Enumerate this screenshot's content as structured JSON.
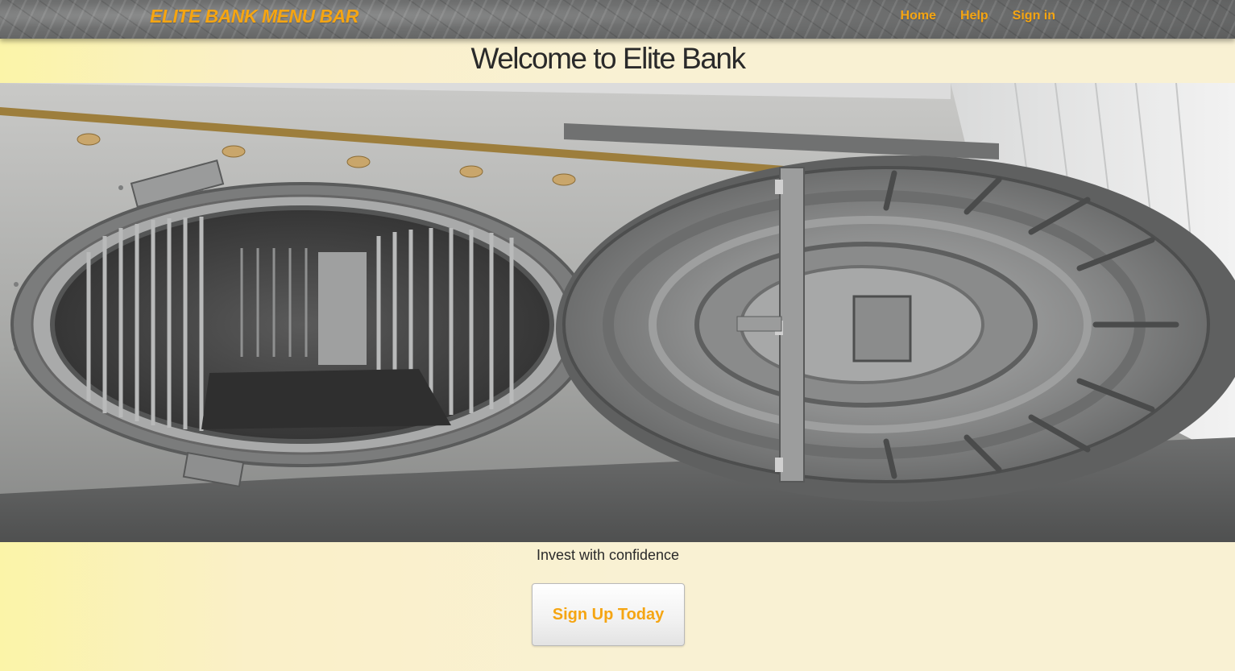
{
  "navbar": {
    "brand": "ELITE BANK MENU BAR",
    "links": [
      {
        "label": "Home"
      },
      {
        "label": "Help"
      },
      {
        "label": "Sign in"
      }
    ]
  },
  "main": {
    "title": "Welcome to Elite Bank",
    "tagline": "Invest with confidence",
    "cta_label": "Sign Up Today"
  },
  "colors": {
    "accent": "#f5a512",
    "page_background": "#f9f1d3",
    "navbar_background": "#6f7070",
    "text": "#2a2a2a"
  }
}
